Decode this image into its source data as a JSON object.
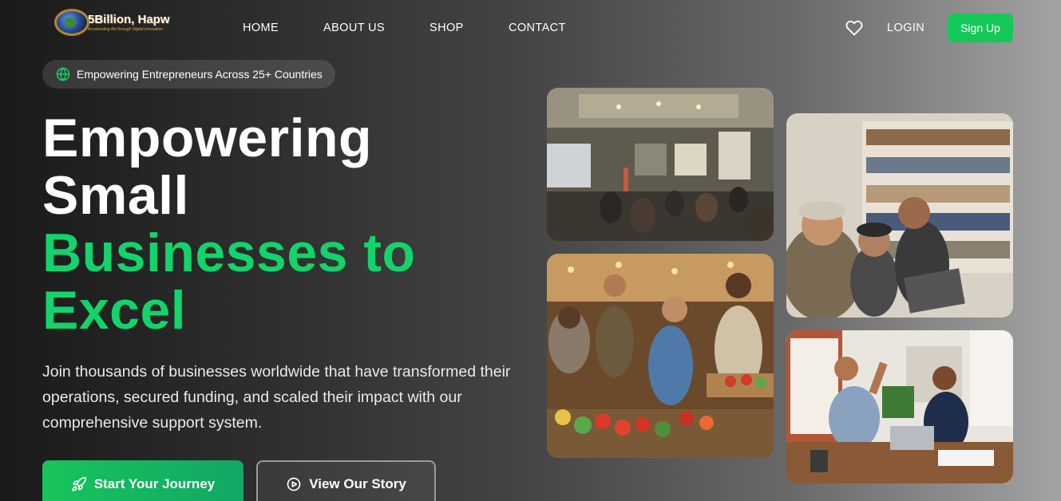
{
  "brand": {
    "name": "5Billion, Hapw",
    "tagline": "Accelerating Aid through Digital Innovation"
  },
  "nav": {
    "items": [
      "HOME",
      "ABOUT US",
      "SHOP",
      "CONTACT"
    ],
    "login": "LOGIN",
    "signup": "Sign Up"
  },
  "badge": {
    "icon": "globe-icon",
    "text": "Empowering Entrepreneurs Across 25+ Countries"
  },
  "hero": {
    "line1": "Empowering",
    "line2": "Small",
    "line3": "Businesses to",
    "line4": "Excel",
    "subtitle": "Join thousands of businesses worldwide that have transformed their operations, secured funding, and scaled their impact with our comprehensive support system.",
    "primary_button": "Start Your Journey",
    "secondary_button": "View Our Story"
  },
  "images": {
    "photo1": "seminar-classroom-photo",
    "photo2": "market-vendors-photo",
    "photo3": "team-laptop-library-photo",
    "photo4": "office-high-five-photo"
  },
  "colors": {
    "accent": "#12d46a",
    "button_green": "#16c75a"
  }
}
